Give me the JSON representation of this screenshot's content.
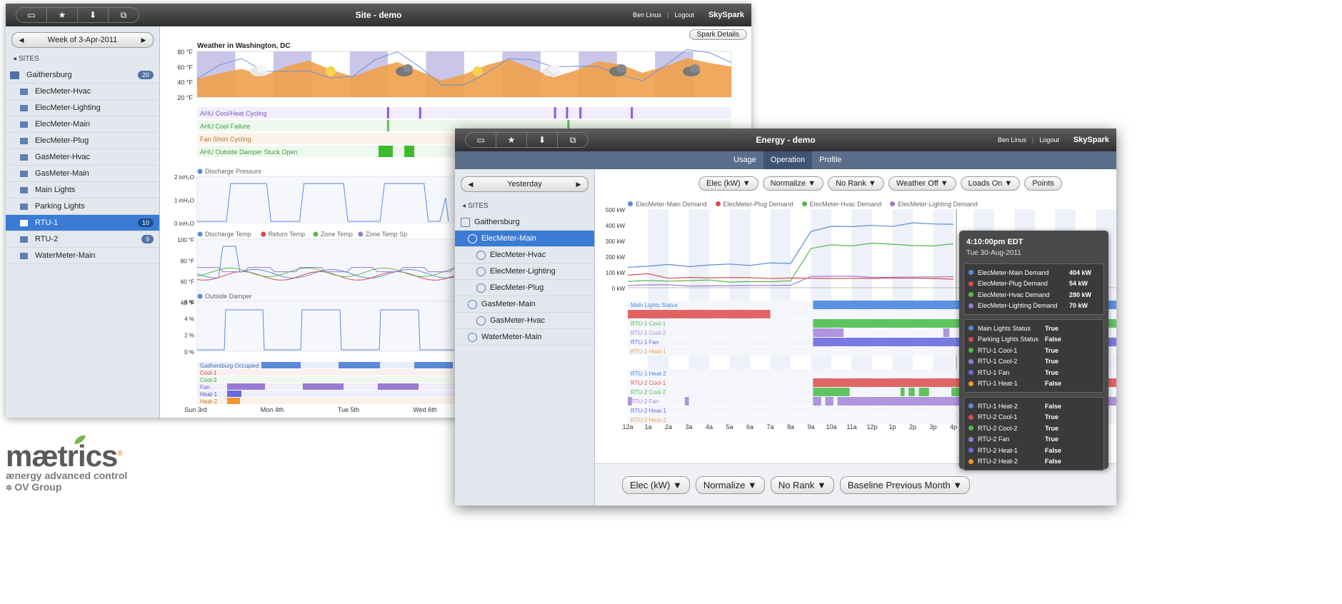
{
  "logo": {
    "word": "mætrics",
    "registered": "®",
    "tagline": "ænergy advanced control",
    "group": "OV Group"
  },
  "site_window": {
    "toolbar_icons": [
      "window-icon",
      "star-icon",
      "download-icon",
      "copy-icon"
    ],
    "title": "Site - demo",
    "user": "Ben Linus",
    "logout": "Logout",
    "brand": "SkySpark",
    "date_nav": "Week of 3-Apr-2011",
    "spark_details": "Spark Details",
    "sites_header": "SITES",
    "sites": [
      {
        "label": "Gaithersburg",
        "badge": "20",
        "kind": "site"
      },
      {
        "label": "ElecMeter-Hvac"
      },
      {
        "label": "ElecMeter-Lighting"
      },
      {
        "label": "ElecMeter-Main"
      },
      {
        "label": "ElecMeter-Plug"
      },
      {
        "label": "GasMeter-Hvac"
      },
      {
        "label": "GasMeter-Main"
      },
      {
        "label": "Main Lights"
      },
      {
        "label": "Parking Lights"
      },
      {
        "label": "RTU-1",
        "badge": "10",
        "selected": true
      },
      {
        "label": "RTU-2",
        "badge": "9"
      },
      {
        "label": "WaterMeter-Main"
      }
    ],
    "weather": {
      "title": "Weather in Washington, DC",
      "yticks": [
        "80 °F",
        "60 °F",
        "40 °F",
        "20 °F"
      ],
      "temps": [
        44,
        51,
        57,
        48,
        60,
        68,
        56,
        47,
        58,
        66,
        54,
        42,
        50,
        62,
        70,
        58,
        46,
        55,
        67,
        63,
        52,
        60,
        71,
        65,
        60
      ],
      "color_fill": "#f0a04b",
      "color_line": "#6f8fd8"
    },
    "sparks": [
      "AHU Cool/Heat Cycling",
      "AHU Cool Failure",
      "Fan Short Cycling",
      "AHU Outside Damper Stuck Open"
    ],
    "discharge_pressure": {
      "legend": "Discharge Pressure",
      "yticks": [
        "2 inH₂O",
        "1 inH₂O",
        "0 inH₂O"
      ]
    },
    "temps_chart": {
      "legend": [
        "Discharge Temp",
        "Return Temp",
        "Zone Temp",
        "Zone Temp Sp"
      ],
      "colors": [
        "#5b8ad8",
        "#d94b4b",
        "#55b84a",
        "#9a7ad0"
      ],
      "yticks": [
        "100 °F",
        "80 °F",
        "60 °F",
        "40 °F"
      ]
    },
    "outside_damper": {
      "legend": "Outside Damper",
      "yticks": [
        "6 %",
        "4 %",
        "2 %",
        "0 %"
      ]
    },
    "status_rows": [
      "Gaithersburg Occupied",
      "Cool-1",
      "Cool-2",
      "Fan",
      "Heat-1",
      "Heat-2"
    ],
    "xaxis": [
      "Sun 3rd",
      "Mon 4th",
      "Tue 5th",
      "Wed 6th"
    ]
  },
  "energy_window": {
    "toolbar_icons": [
      "window-icon",
      "star-icon",
      "download-icon",
      "copy-icon"
    ],
    "title": "Energy - demo",
    "user": "Ben Linus",
    "logout": "Logout",
    "brand": "SkySpark",
    "tabs": [
      "Usage",
      "Operation",
      "Profile"
    ],
    "active_tab": "Operation",
    "date_nav": "Yesterday",
    "sites_header": "SITES",
    "sites": [
      {
        "label": "Gaithersburg",
        "kind": "site"
      },
      {
        "label": "ElecMeter-Main",
        "kind": "meter",
        "selected": true
      },
      {
        "label": "ElecMeter-Hvac",
        "kind": "submeter"
      },
      {
        "label": "ElecMeter-Lighting",
        "kind": "submeter"
      },
      {
        "label": "ElecMeter-Plug",
        "kind": "submeter"
      },
      {
        "label": "GasMeter-Main",
        "kind": "meter"
      },
      {
        "label": "GasMeter-Hvac",
        "kind": "submeter"
      },
      {
        "label": "WaterMeter-Main",
        "kind": "meter"
      }
    ],
    "toolbar": [
      "Elec (kW) ▼",
      "Normalize ▼",
      "No Rank ▼",
      "Weather Off ▼",
      "Loads On ▼",
      "Points"
    ],
    "legend": [
      {
        "label": "ElecMeter-Main Demand",
        "color": "#5b8ad8"
      },
      {
        "label": "ElecMeter-Plug Demand",
        "color": "#d94b4b"
      },
      {
        "label": "ElecMeter-Hvac Demand",
        "color": "#55b84a"
      },
      {
        "label": "ElecMeter-Lighting Demand",
        "color": "#9a7ad0"
      }
    ],
    "yticks": [
      "500 kW",
      "400 kW",
      "300 kW",
      "200 kW",
      "100 kW",
      "0 kW"
    ],
    "chart_data": {
      "type": "line",
      "ylim": [
        0,
        500
      ],
      "x": [
        "12a",
        "1a",
        "2a",
        "3a",
        "4a",
        "5a",
        "6a",
        "7a",
        "8a",
        "9a",
        "10a",
        "11a",
        "12p",
        "1p",
        "2p",
        "3p",
        "4p"
      ],
      "series": [
        {
          "name": "ElecMeter-Main Demand",
          "values": [
            130,
            140,
            150,
            135,
            145,
            150,
            140,
            155,
            150,
            370,
            400,
            395,
            400,
            390,
            410,
            400,
            404
          ]
        },
        {
          "name": "ElecMeter-Plug Demand",
          "values": [
            80,
            90,
            60,
            65,
            60,
            62,
            60,
            62,
            65,
            62,
            60,
            60,
            58,
            60,
            58,
            55,
            54
          ]
        },
        {
          "name": "ElecMeter-Hvac Demand",
          "values": [
            40,
            45,
            40,
            42,
            45,
            40,
            42,
            40,
            45,
            250,
            270,
            260,
            275,
            265,
            280,
            275,
            280
          ]
        },
        {
          "name": "ElecMeter-Lighting Demand",
          "values": [
            15,
            15,
            15,
            15,
            15,
            15,
            15,
            15,
            15,
            70,
            70,
            70,
            70,
            70,
            70,
            70,
            70
          ]
        }
      ]
    },
    "status_group1": [
      {
        "label": "Main Lights Status",
        "color": "#4a86e0"
      },
      {
        "label": "Parking Lights Status",
        "color": "#e05555"
      },
      {
        "label": "RTU-1 Cool-1",
        "color": "#4fbf4f"
      },
      {
        "label": "RTU-1 Cool-2",
        "color": "#a889d8"
      },
      {
        "label": "RTU-1 Fan",
        "color": "#6b6be0"
      },
      {
        "label": "RTU-1 Heat-1",
        "color": "#f0a050"
      }
    ],
    "status_group2": [
      {
        "label": "RTU-1 Heat-2",
        "color": "#4a86e0"
      },
      {
        "label": "RTU-2 Cool-1",
        "color": "#e05555"
      },
      {
        "label": "RTU-2 Cool-2",
        "color": "#4fbf4f"
      },
      {
        "label": "RTU-2 Fan",
        "color": "#a889d8"
      },
      {
        "label": "RTU-2 Heat-1",
        "color": "#6b6be0"
      },
      {
        "label": "RTU-2 Heat-2",
        "color": "#f0a050"
      }
    ],
    "xaxis": [
      "12a",
      "1a",
      "2a",
      "3a",
      "4a",
      "5a",
      "6a",
      "7a",
      "8a",
      "9a",
      "10a",
      "11a",
      "12p",
      "1p",
      "2p",
      "3p",
      "4p"
    ],
    "bottom_toolbar": [
      "Elec (kW) ▼",
      "Normalize ▼",
      "No Rank ▼",
      "Baseline Previous Month ▼"
    ],
    "tooltip": {
      "time": "4:10:00pm EDT",
      "date": "Tue 30-Aug-2011",
      "groups": [
        [
          {
            "label": "ElecMeter-Main Demand",
            "value": "404 kW",
            "color": "#5b8ad8"
          },
          {
            "label": "ElecMeter-Plug Demand",
            "value": "54 kW",
            "color": "#d94b4b"
          },
          {
            "label": "ElecMeter-Hvac Demand",
            "value": "280 kW",
            "color": "#55b84a"
          },
          {
            "label": "ElecMeter-Lighting Demand",
            "value": "70 kW",
            "color": "#9a7ad0"
          }
        ],
        [
          {
            "label": "Main Lights Status",
            "value": "True",
            "color": "#5b8ad8"
          },
          {
            "label": "Parking Lights Status",
            "value": "False",
            "color": "#d94b4b"
          },
          {
            "label": "RTU-1 Cool-1",
            "value": "True",
            "color": "#55b84a"
          },
          {
            "label": "RTU-1 Cool-2",
            "value": "True",
            "color": "#9a7ad0"
          },
          {
            "label": "RTU-1 Fan",
            "value": "True",
            "color": "#6b6be0"
          },
          {
            "label": "RTU-1 Heat-1",
            "value": "False",
            "color": "#f0962e"
          }
        ],
        [
          {
            "label": "RTU-1 Heat-2",
            "value": "False",
            "color": "#5b8ad8"
          },
          {
            "label": "RTU-2 Cool-1",
            "value": "True",
            "color": "#d94b4b"
          },
          {
            "label": "RTU-2 Cool-2",
            "value": "True",
            "color": "#55b84a"
          },
          {
            "label": "RTU-2 Fan",
            "value": "True",
            "color": "#9a7ad0"
          },
          {
            "label": "RTU-2 Heat-1",
            "value": "False",
            "color": "#6b6be0"
          },
          {
            "label": "RTU-2 Heat-2",
            "value": "False",
            "color": "#f0962e"
          }
        ]
      ]
    }
  }
}
